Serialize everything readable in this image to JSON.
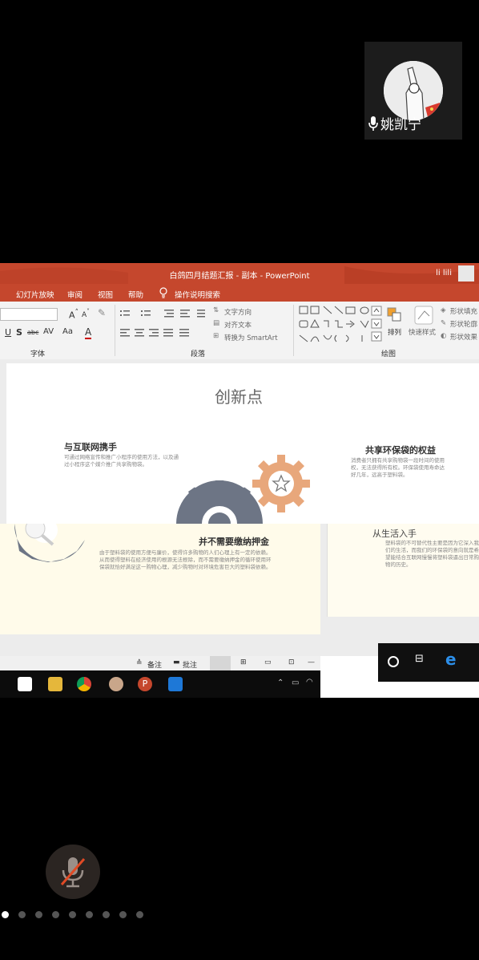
{
  "participant": {
    "name": "姚凯宁"
  },
  "powerpoint": {
    "window_title": "白鸽四月结题汇报 - 副本 -  PowerPoint",
    "user_name": "li lili",
    "menu": [
      "幻灯片放映",
      "审阅",
      "视图",
      "帮助"
    ],
    "search_hint": "操作说明搜索",
    "ribbon": {
      "font_group_label": "字体",
      "paragraph_group_label": "段落",
      "drawing_group_label": "绘图",
      "text_direction": "文字方向",
      "align_text": "对齐文本",
      "convert_smartart": "转换为 SmartArt",
      "arrange": "排列",
      "quick_styles": "快速样式",
      "shape_fill": "形状填充",
      "shape_outline": "形状轮廓",
      "shape_effects": "形状效果"
    },
    "slide": {
      "title": "创新点",
      "left_heading": "与互联网携手",
      "left_body": "可通过网络宣传和推广小程序的使用方法，以及通过小程序这个媒介推广共享购物袋。",
      "right_heading": "共享环保袋的权益",
      "right_body": "消费者只拥有共享购物袋一段时间的使用权，无法获得所有权。环保袋使用寿命达好几年，远高于塑料袋。",
      "center_heading": "并不需要缴纳押金",
      "center_body": "由于塑料袋的使用方便与廉价，使得许多购物的人们心理上有一定的依赖。从而使得塑料在经济使用的根源无法根除，而不需要缴纳押金的循环使用环保袋就恰好满足这一购物心理，减少购物时对环境危害巨大的塑料袋依赖。",
      "right_panel_heading": "从生活入手",
      "right_panel_body": "塑料袋的不可替代性主要是因为它深入我们的生活，而我们的环保袋的意向就是希望能结合互联网慢慢将塑料袋逼出日常购物的历史。"
    },
    "statusbar": {
      "notes": "备注",
      "comments": "批注"
    }
  },
  "pager": {
    "count": 9,
    "active": 0
  },
  "colors": {
    "accent": "#c5472d",
    "gear_gray": "#6d7585",
    "gear_orange": "#e8a77b"
  }
}
